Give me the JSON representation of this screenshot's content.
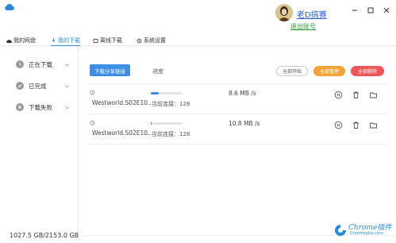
{
  "header": {
    "username": "老D搞赛",
    "logout_label": "退出账号"
  },
  "tabs": [
    {
      "label": "我的网盘",
      "icon": "cloud-icon"
    },
    {
      "label": "我的下载",
      "icon": "download-icon",
      "active": true
    },
    {
      "label": "离线下载",
      "icon": "offline-icon"
    },
    {
      "label": "系统设置",
      "icon": "gear-icon"
    }
  ],
  "sidebar": {
    "items": [
      {
        "label": "正在下载",
        "icon": "clock-icon"
      },
      {
        "label": "已完成",
        "icon": "check-circle-icon"
      },
      {
        "label": "下载失败",
        "icon": "x-circle-icon"
      }
    ],
    "storage": "1027.5 GB/2153.0 GB"
  },
  "toolbar": {
    "share_label": "下载分享链接",
    "progress_label": "进度",
    "start_all": "全部开始",
    "pause_all": "全部暂停",
    "delete_all": "全部删除"
  },
  "downloads": [
    {
      "name": "Westworld.S02E10...",
      "progress": 0.25,
      "speed": "8.6 MB /s",
      "connections": "当前连接：128"
    },
    {
      "name": "Westworld.S02E10...",
      "progress": 0.03,
      "speed": "10.8 MB /s",
      "connections": "当前连接：128"
    }
  ],
  "watermark": {
    "brand": "Chrome插件",
    "sub": "Chromeplus.com"
  },
  "colors": {
    "accent": "#3e8ee6",
    "pause": "#f0a43a",
    "delete": "#ee5757",
    "link": "#2a5fd6",
    "logout": "#2e9a36"
  }
}
